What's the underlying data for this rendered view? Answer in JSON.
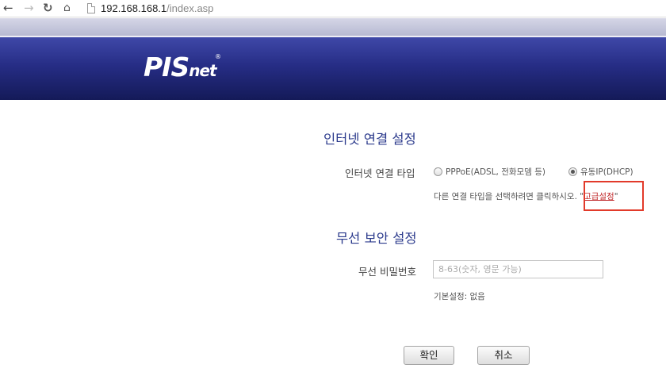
{
  "browser": {
    "url_host": "192.168.168.1",
    "url_path": "/index.asp",
    "icons": [
      "back-arrow-icon",
      "forward-arrow-icon",
      "reload-icon",
      "home-icon",
      "page-icon"
    ]
  },
  "header": {
    "logo_main": "PIS",
    "logo_sub": "net",
    "logo_reg": "®",
    "colors": {
      "header_top": "#3f48a8",
      "header_bottom": "#141a58",
      "topbar": "#c6c8dc"
    }
  },
  "internet": {
    "title": "인터넷 연결 설정",
    "type_label": "인터넷 연결 타입",
    "options": [
      {
        "label": "PPPoE(ADSL, 전화모뎀 등)",
        "checked": false
      },
      {
        "label": "유동IP(DHCP)",
        "checked": true
      }
    ],
    "hint_prefix": "다른 연결 타입을 선택하려면 클릭하시오. \"",
    "advanced_link": "고급설정",
    "hint_suffix": "\"",
    "link_color": "#c0282a"
  },
  "wireless": {
    "title": "무선 보안 설정",
    "password_label": "무선 비밀번호",
    "password_placeholder": "8-63(숫자, 영문 가능)",
    "password_value": "",
    "default_note": "기본설정: 없음"
  },
  "buttons": {
    "ok": "확인",
    "cancel": "취소"
  },
  "accent_color": "#2b3a8c",
  "highlight_color": "#e23a2a"
}
